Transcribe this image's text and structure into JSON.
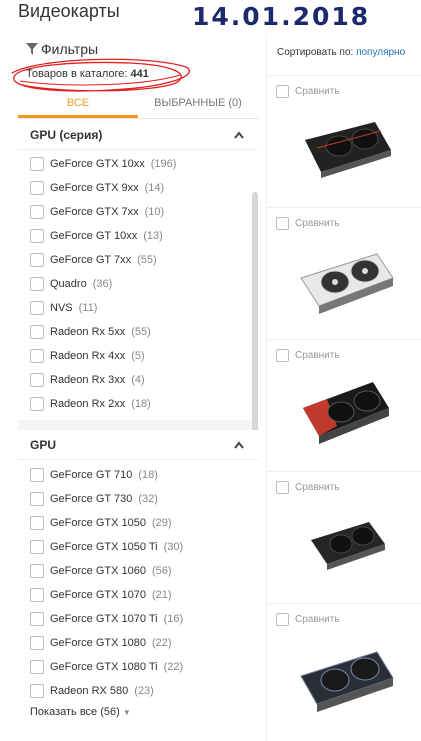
{
  "page": {
    "title": "Видеокарты",
    "date_stamp": "14.01.2018"
  },
  "filters": {
    "header": "Фильтры",
    "catalog_label": "Товаров в каталоге:",
    "catalog_count": "441",
    "tabs": [
      {
        "label": "ВСЕ",
        "active": true
      },
      {
        "label": "ВЫБРАННЫЕ (0)",
        "active": false
      }
    ],
    "sections": [
      {
        "title": "GPU (серия)",
        "items": [
          {
            "label": "GeForce GTX 10xx",
            "count": "(196)"
          },
          {
            "label": "GeForce GTX 9xx",
            "count": "(14)"
          },
          {
            "label": "GeForce GTX 7xx",
            "count": "(10)"
          },
          {
            "label": "GeForce GT 10xx",
            "count": "(13)"
          },
          {
            "label": "GeForce GT 7xx",
            "count": "(55)"
          },
          {
            "label": "Quadro",
            "count": "(36)"
          },
          {
            "label": "NVS",
            "count": "(11)"
          },
          {
            "label": "Radeon Rx 5xx",
            "count": "(55)"
          },
          {
            "label": "Radeon Rx 4xx",
            "count": "(5)"
          },
          {
            "label": "Radeon Rx 3xx",
            "count": "(4)"
          },
          {
            "label": "Radeon Rx 2xx",
            "count": "(18)"
          }
        ]
      },
      {
        "title": "GPU",
        "items": [
          {
            "label": "GeForce GT 710",
            "count": "(18)"
          },
          {
            "label": "GeForce GT 730",
            "count": "(32)"
          },
          {
            "label": "GeForce GTX 1050",
            "count": "(29)"
          },
          {
            "label": "GeForce GTX 1050 Ti",
            "count": "(30)"
          },
          {
            "label": "GeForce GTX 1060",
            "count": "(56)"
          },
          {
            "label": "GeForce GTX 1070",
            "count": "(21)"
          },
          {
            "label": "GeForce GTX 1070 Ti",
            "count": "(16)"
          },
          {
            "label": "GeForce GTX 1080",
            "count": "(22)"
          },
          {
            "label": "GeForce GTX 1080 Ti",
            "count": "(22)"
          },
          {
            "label": "Radeon RX 580",
            "count": "(23)"
          }
        ],
        "show_all": "Показать все (56)"
      }
    ]
  },
  "products": {
    "sort_label": "Сортировать по:",
    "sort_value": "популярно",
    "compare_label": "Сравнить",
    "cards": [
      {
        "icon": "gpu-black-dual-fan-icon"
      },
      {
        "icon": "gpu-white-dual-fan-icon"
      },
      {
        "icon": "gpu-red-black-dual-fan-icon"
      },
      {
        "icon": "gpu-black-compact-icon"
      },
      {
        "icon": "gpu-blue-black-dual-fan-icon"
      }
    ]
  },
  "colors": {
    "accent": "#f49a22",
    "link": "#1f6fb8",
    "stamp": "#1a2a6c",
    "scribble": "#e02020"
  }
}
